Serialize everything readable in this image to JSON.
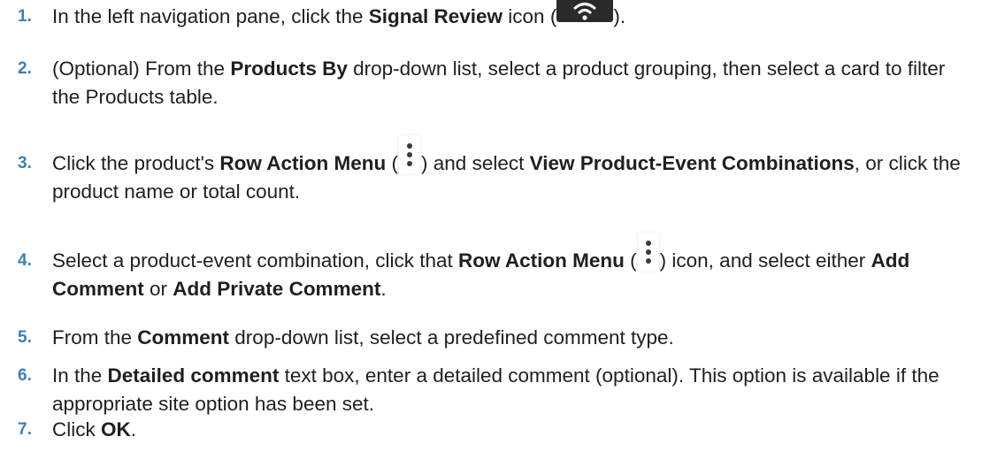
{
  "steps": [
    {
      "number": "1.",
      "t1": "In the left navigation pane, click the ",
      "b1": "Signal Review",
      "t2": " icon (",
      "icon": "wifi-signal-icon",
      "t3": ")."
    },
    {
      "number": "2.",
      "t1": "(Optional) From the ",
      "b1": "Products By",
      "t2": " drop-down list, select a product grouping, then select a card to filter the Products table."
    },
    {
      "number": "3.",
      "t1": "Click the product's ",
      "b1": "Row Action Menu",
      "t2": " (",
      "icon": "kebab-menu-icon",
      "t3": ") and select ",
      "b2": "View Product-Event Combinations",
      "t4": ", or click the product name or total count."
    },
    {
      "number": "4.",
      "t1": "Select a product-event combination, click that ",
      "b1": "Row Action Menu",
      "t2": " (",
      "icon": "kebab-menu-icon",
      "t3": ") icon, and select either ",
      "b2": "Add Comment",
      "t4": " or ",
      "b3": "Add Private Comment",
      "t5": "."
    },
    {
      "number": "5.",
      "t1": "From the ",
      "b1": "Comment",
      "t2": " drop-down list, select a predefined comment type."
    },
    {
      "number": "6.",
      "t1": "In the ",
      "b1": "Detailed comment",
      "t2": " text box, enter a detailed comment (optional). This option is available if the appropriate site option has been set."
    },
    {
      "number": "7.",
      "t1": "Click ",
      "b1": "OK",
      "t2": "."
    }
  ],
  "colors": {
    "step_number": "#3f7fb0",
    "text": "#1f1f1f",
    "icon_dark": "#2a2a2a"
  }
}
